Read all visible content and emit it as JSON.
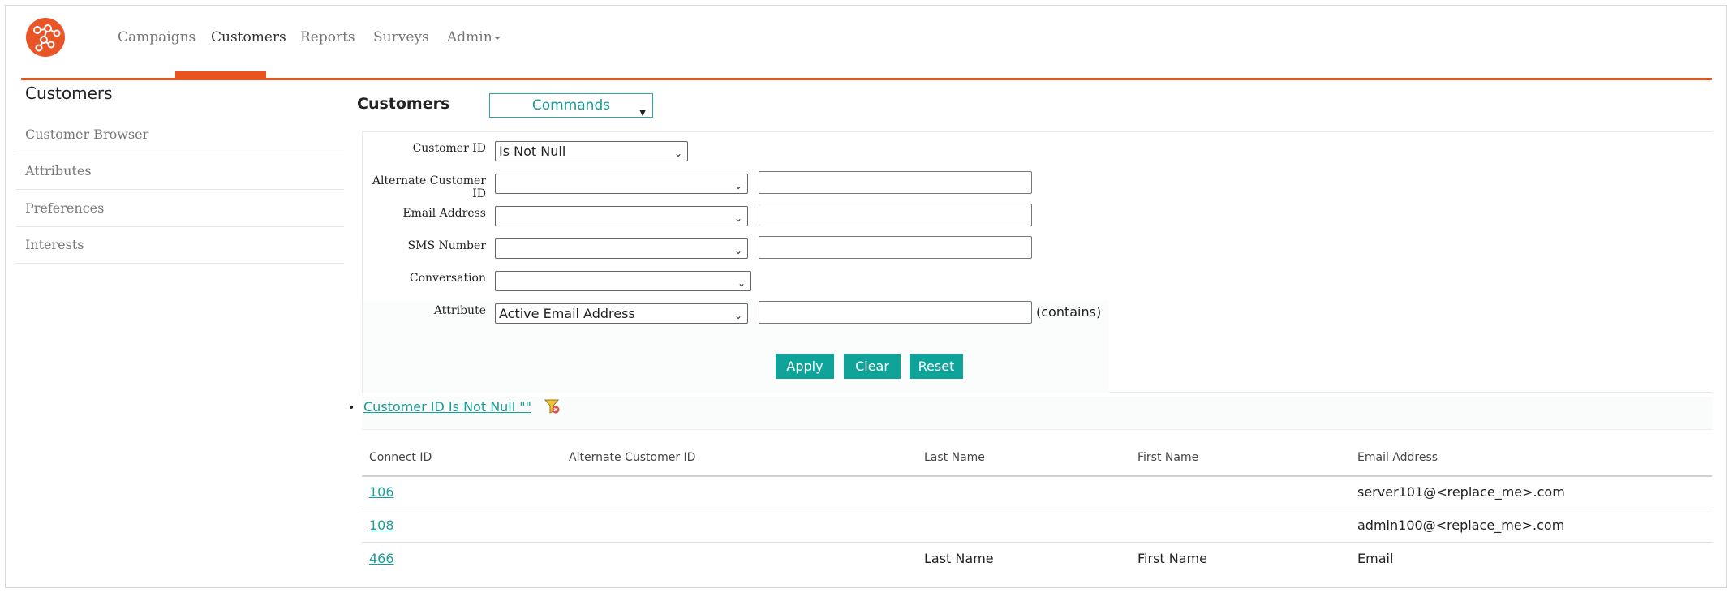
{
  "nav": {
    "items": [
      {
        "label": "Campaigns"
      },
      {
        "label": "Customers"
      },
      {
        "label": "Reports"
      },
      {
        "label": "Surveys"
      },
      {
        "label": "Admin"
      }
    ],
    "active": "Customers",
    "accent_color": "#e8531f"
  },
  "sidebar": {
    "title": "Customers",
    "items": [
      {
        "label": "Customer Browser"
      },
      {
        "label": "Attributes"
      },
      {
        "label": "Preferences"
      },
      {
        "label": "Interests"
      }
    ]
  },
  "main": {
    "title": "Customers",
    "commands_label": "Commands"
  },
  "filters": {
    "customer_id": {
      "label": "Customer ID",
      "operator": "Is Not Null"
    },
    "alternate_customer_id": {
      "label": "Alternate Customer ID",
      "operator": "",
      "value": ""
    },
    "email_address": {
      "label": "Email Address",
      "operator": "",
      "value": ""
    },
    "sms_number": {
      "label": "SMS Number",
      "operator": "",
      "value": ""
    },
    "conversation": {
      "label": "Conversation",
      "operator": ""
    },
    "attribute": {
      "label": "Attribute",
      "selected": "Active Email Address",
      "value": "",
      "suffix": "(contains)"
    }
  },
  "actions": {
    "apply": "Apply",
    "clear": "Clear",
    "reset": "Reset",
    "button_color": "#10a39a"
  },
  "active_filter": {
    "text": "Customer ID Is Not Null \"\"",
    "icon": "filter-remove-icon"
  },
  "table": {
    "columns": [
      "Connect ID",
      "Alternate Customer ID",
      "Last Name",
      "First Name",
      "Email Address"
    ],
    "rows": [
      {
        "connect_id": "106",
        "alternate_id": "",
        "last_name": "",
        "first_name": "",
        "email": "server101@<replace_me>.com"
      },
      {
        "connect_id": "108",
        "alternate_id": "",
        "last_name": "",
        "first_name": "",
        "email": "admin100@<replace_me>.com"
      },
      {
        "connect_id": "466",
        "alternate_id": "",
        "last_name": "Last Name",
        "first_name": "First Name",
        "email": "Email"
      }
    ]
  }
}
